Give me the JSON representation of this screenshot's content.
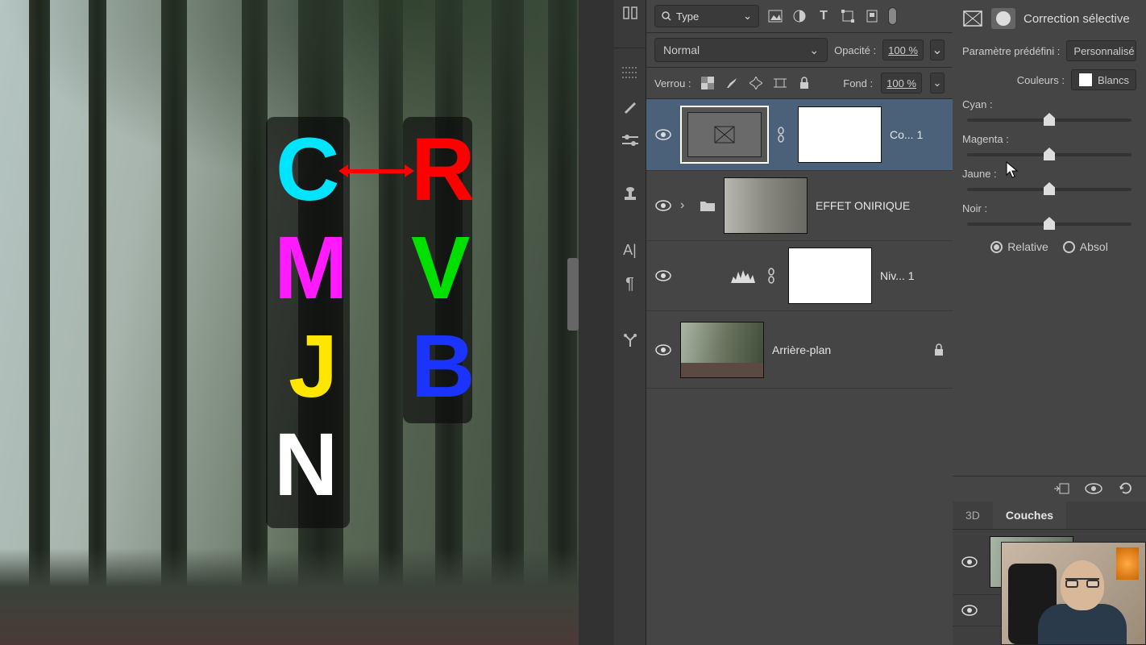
{
  "layers_panel": {
    "filter": {
      "label": "Type"
    },
    "blend_mode": "Normal",
    "opacity": {
      "label": "Opacité :",
      "value": "100 %"
    },
    "lock": {
      "label": "Verrou :"
    },
    "fill": {
      "label": "Fond :",
      "value": "100 %"
    },
    "layers": [
      {
        "name": "Co... 1",
        "type": "adj-selective-color"
      },
      {
        "name": "EFFET ONIRIQUE",
        "type": "group"
      },
      {
        "name": "Niv... 1",
        "type": "adj-levels"
      },
      {
        "name": "Arrière-plan",
        "type": "bg",
        "locked": true
      }
    ]
  },
  "properties": {
    "title": "Correction sélective",
    "preset": {
      "label": "Paramètre prédéfini :",
      "value": "Personnalisé"
    },
    "colors": {
      "label": "Couleurs :",
      "value": "Blancs"
    },
    "sliders": {
      "cyan": "Cyan :",
      "magenta": "Magenta :",
      "jaune": "Jaune :",
      "noir": "Noir :"
    },
    "method": {
      "relative": "Relative",
      "absolute": "Absol"
    }
  },
  "channels": {
    "tabs": {
      "d3": "3D",
      "couches": "Couches"
    }
  },
  "overlay": {
    "left_letters": [
      "C",
      "M",
      "J",
      "N"
    ],
    "right_letters": [
      "R",
      "V",
      "B"
    ]
  }
}
